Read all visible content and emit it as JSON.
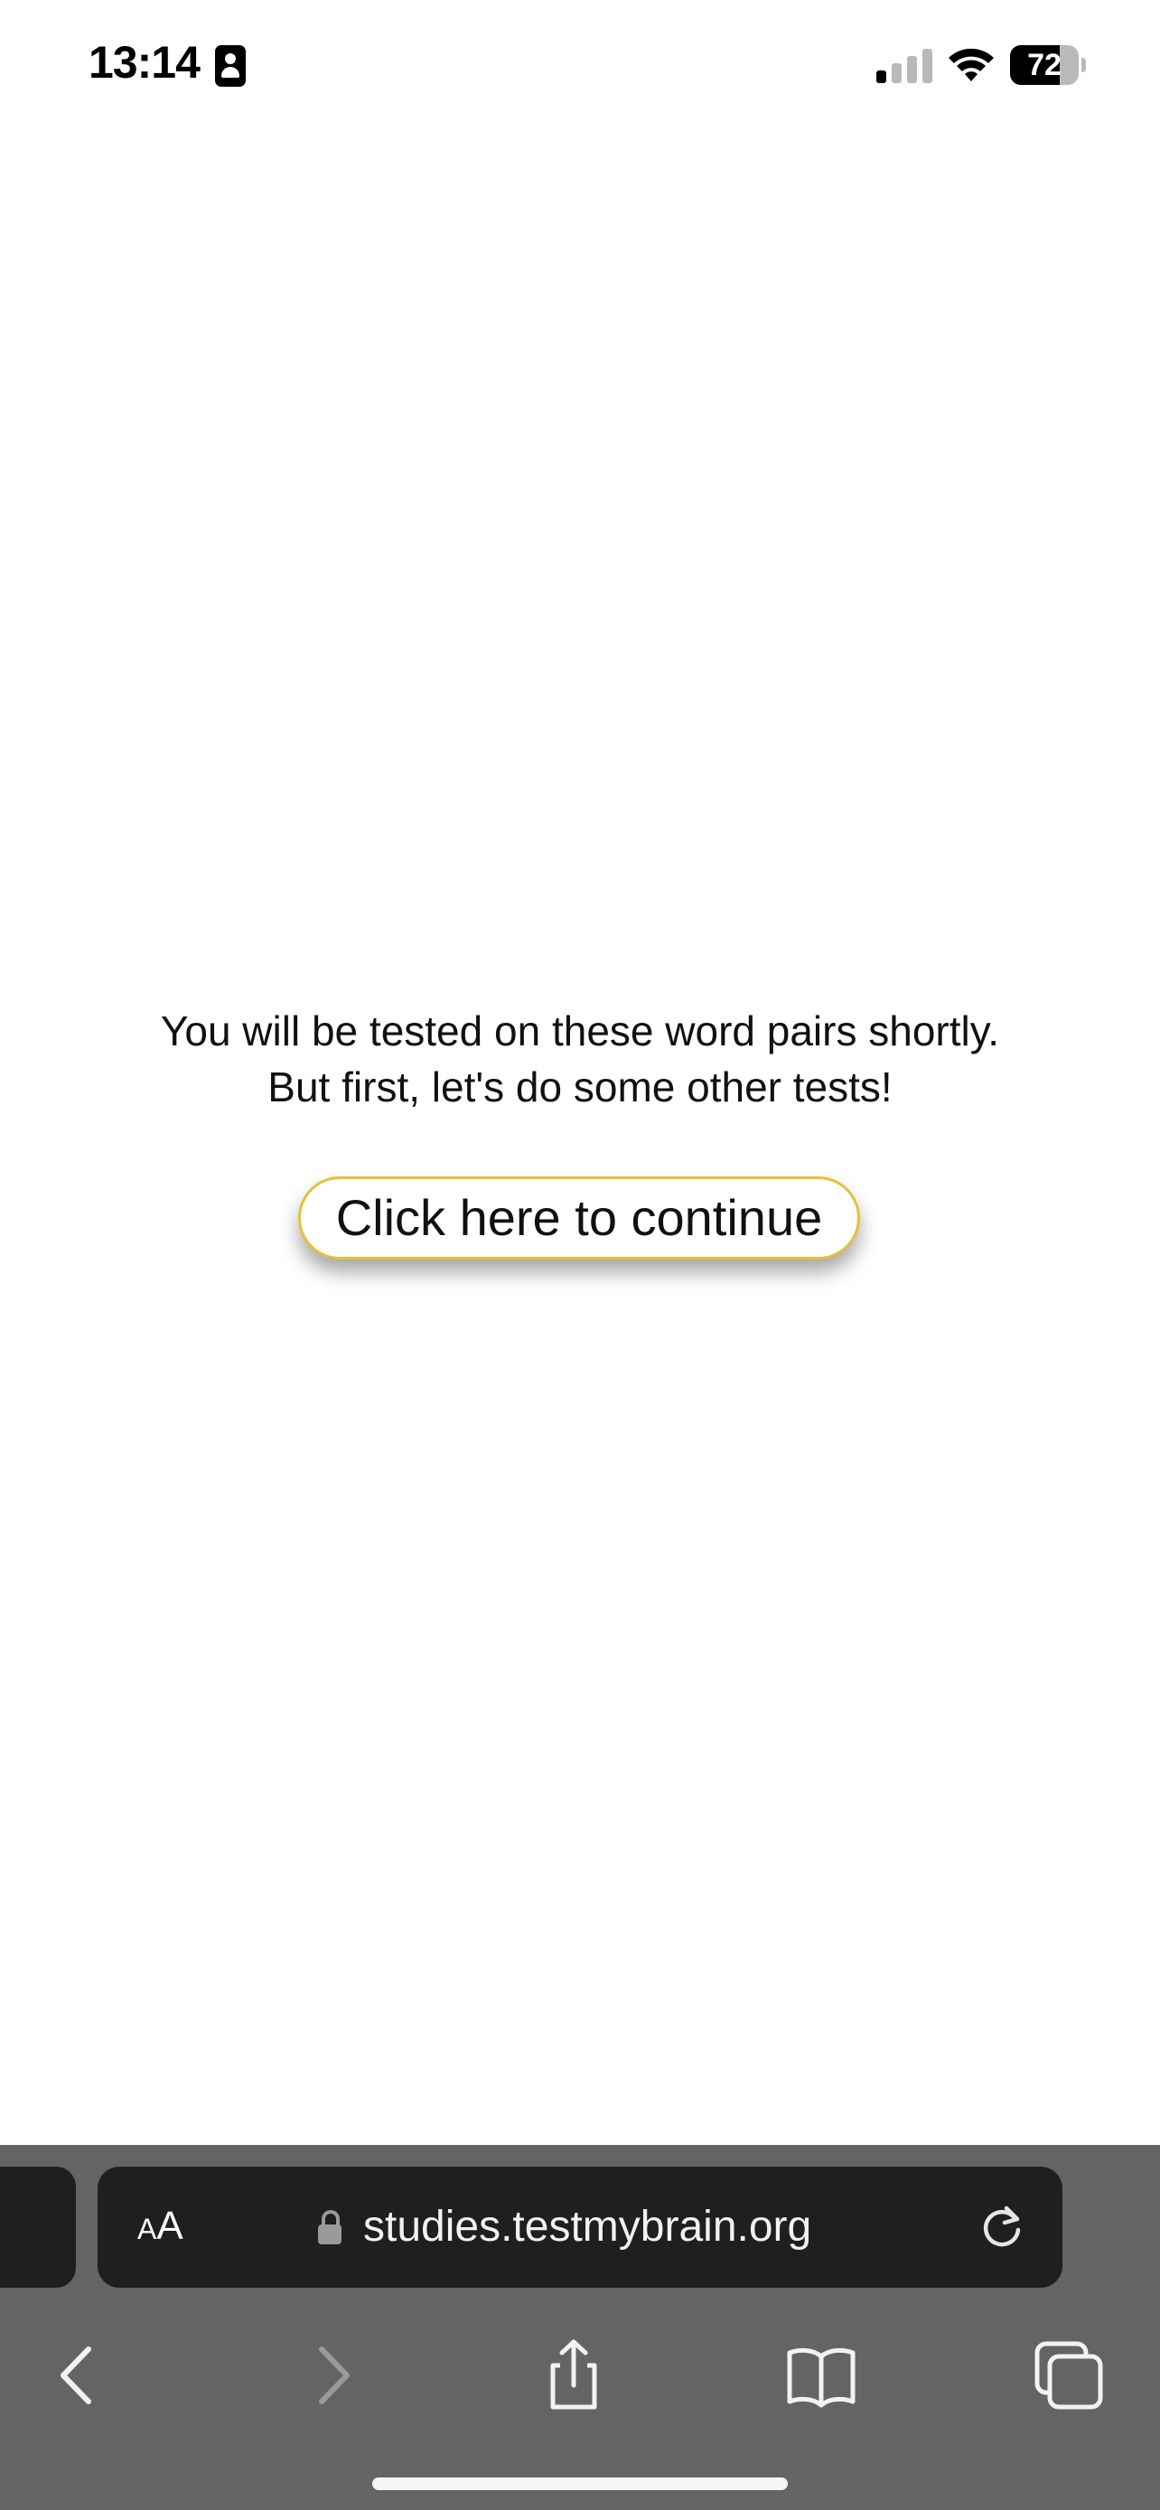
{
  "status_bar": {
    "time": "13:14",
    "battery_level": "72",
    "battery_percent": 72,
    "signal_bars_active": 1,
    "signal_bars_total": 4
  },
  "main": {
    "message_line1": "You will be tested on these word pairs shortly.",
    "message_line2": "But first, let's do some other tests!",
    "continue_button_label": "Click here to continue",
    "button_border_color": "#e3c23a"
  },
  "browser": {
    "text_size_small": "A",
    "text_size_large": "A",
    "url": "studies.testmybrain.org",
    "chrome_color": "#646464",
    "address_bar_color": "#1f1f1f"
  },
  "icons": {
    "contact": "contact-card-icon",
    "signal": "cellular-signal-icon",
    "wifi": "wifi-icon",
    "battery": "battery-icon",
    "lock": "lock-icon",
    "reload": "reload-icon",
    "back": "back-chevron-icon",
    "forward": "forward-chevron-icon",
    "share": "share-icon",
    "bookmarks": "bookmarks-book-icon",
    "tabs": "tabs-icon"
  }
}
